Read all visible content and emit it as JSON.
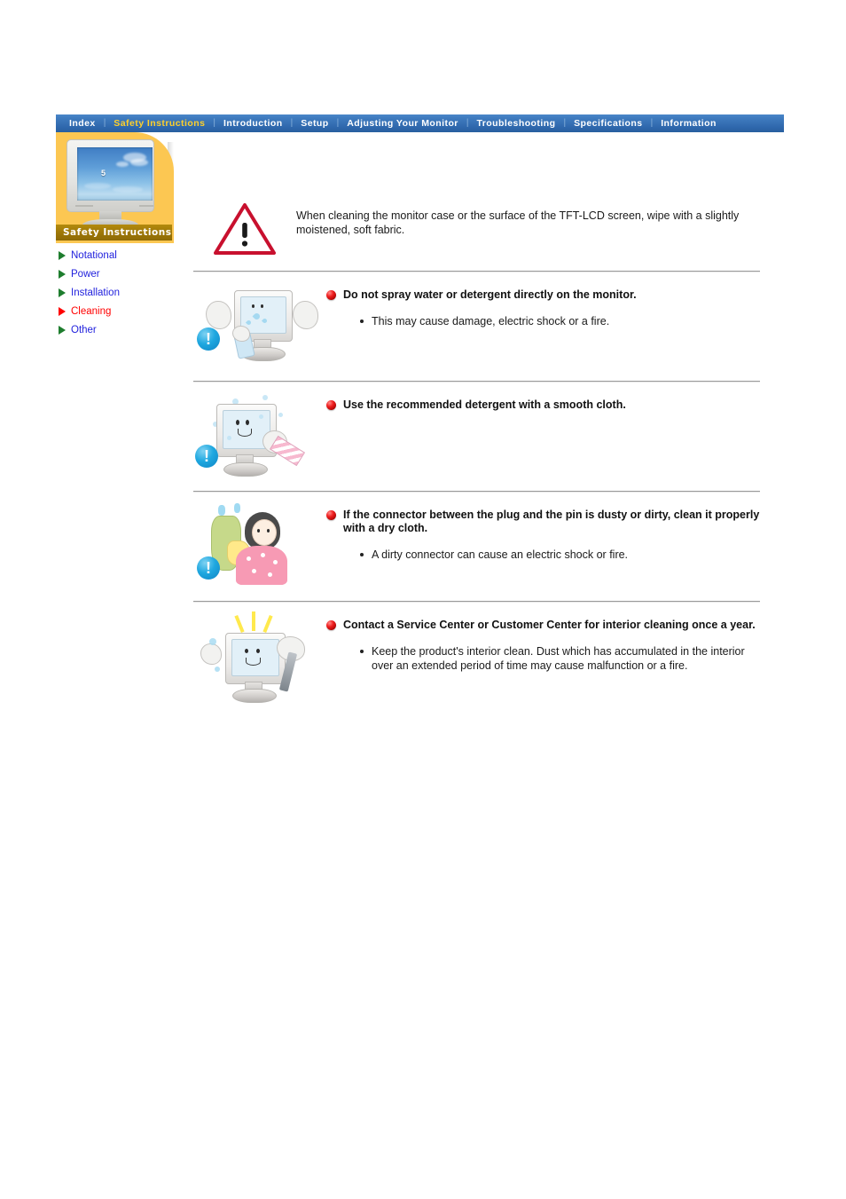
{
  "nav": {
    "items": [
      {
        "label": "Index",
        "active": false
      },
      {
        "label": "Safety Instructions",
        "active": true
      },
      {
        "label": "Introduction",
        "active": false
      },
      {
        "label": "Setup",
        "active": false
      },
      {
        "label": "Adjusting Your Monitor",
        "active": false
      },
      {
        "label": "Troubleshooting",
        "active": false
      },
      {
        "label": "Specifications",
        "active": false
      },
      {
        "label": "Information",
        "active": false
      }
    ],
    "separator": "|",
    "active_color": "#ffd02a",
    "text_color": "#ffffff",
    "bar_color": "#3973b7"
  },
  "sidebar": {
    "caption": "Safety Instructions",
    "panel_color": "#fcc752",
    "caption_band_color": "#9c7607",
    "thumbnail_label": "5",
    "items": [
      {
        "label": "Notational",
        "active": false
      },
      {
        "label": "Power",
        "active": false
      },
      {
        "label": "Installation",
        "active": false
      },
      {
        "label": "Cleaning",
        "active": true
      },
      {
        "label": "Other",
        "active": false
      }
    ],
    "link_color": "#2222dd",
    "active_link_color": "#ff0000",
    "arrow_color": "#1e7d2e",
    "active_arrow_color": "#ff0000"
  },
  "intro": {
    "icon": "warning-triangle-icon",
    "text": "When cleaning the monitor case or the surface of the TFT-LCD screen, wipe with a slightly moistened, soft fabric."
  },
  "sections": [
    {
      "art": "monitor-spray-illustration",
      "heading": "Do not spray water or detergent directly on the monitor.",
      "bullets": [
        "This may cause damage, electric shock or a fire."
      ]
    },
    {
      "art": "monitor-wipe-cloth-illustration",
      "heading": "Use the recommended detergent with a smooth cloth.",
      "bullets": []
    },
    {
      "art": "girl-cleaning-plug-illustration",
      "heading": "If the connector between the plug and the pin is dusty or dirty, clean it properly with a dry cloth.",
      "bullets": [
        "A dirty connector can cause an electric shock or fire."
      ]
    },
    {
      "art": "service-center-interior-cleaning-illustration",
      "heading": "Contact a Service Center or Customer Center for interior cleaning once a year.",
      "bullets": [
        "Keep the product's interior clean. Dust which has accumulated in the interior over an extended period of time may cause malfunction or a fire."
      ]
    }
  ]
}
